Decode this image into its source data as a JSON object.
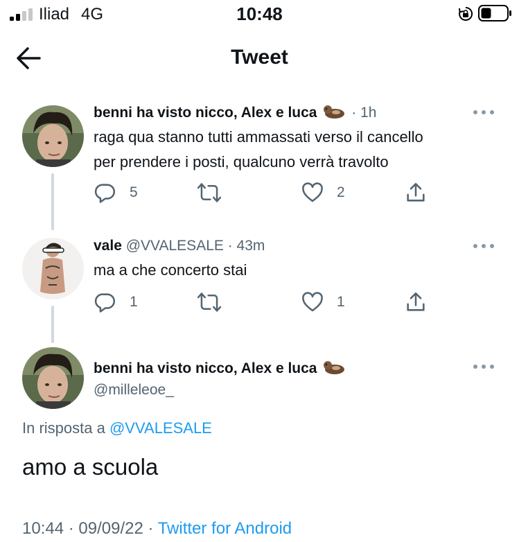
{
  "status_bar": {
    "carrier": "Iliad",
    "network": "4G",
    "time": "10:48"
  },
  "header": {
    "title": "Tweet"
  },
  "tweets": [
    {
      "name": "benni ha visto nicco, Alex e luca",
      "emoji_icon": "otter-emoji",
      "meta": "· 1h",
      "text_line1": "raga qua stanno tutti ammassati verso il cancello",
      "text_line2": "per prendere i posti, qualcuno verrà travolto",
      "replies": "5",
      "likes": "2"
    },
    {
      "name": "vale",
      "meta": "@VVALESALE · 43m",
      "text_line1": "ma a che concerto stai",
      "replies": "1",
      "likes": "1"
    }
  ],
  "main_tweet": {
    "name": "benni ha visto nicco, Alex e luca",
    "emoji_icon": "otter-emoji",
    "handle": "@milleleoe_",
    "reply_prefix": "In risposta a",
    "reply_handle": "@VVALESALE",
    "text": "amo a scuola",
    "timestamp": "10:44 · 09/09/22 ·",
    "source": "Twitter for Android"
  },
  "colors": {
    "accent": "#1d9bf0",
    "secondary_text": "#536471",
    "thread_line": "#cfd9de"
  }
}
